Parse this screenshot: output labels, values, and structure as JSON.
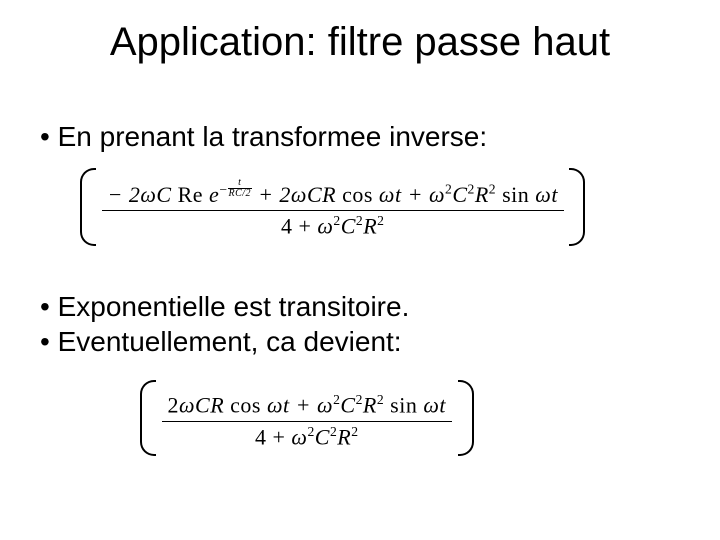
{
  "slide": {
    "title": "Application: filtre passe haut",
    "bullets": {
      "b1": "En prenant la transformee inverse:",
      "b2": "Exponentielle est transitoire.",
      "b3": "Eventuellement, ca devient:"
    },
    "formulas": {
      "f1": {
        "numerator_terms": [
          "− 2ωC Re",
          "e^{−t/(RC/2)}",
          "+ 2ωCR cos ωt",
          "+ ω²C²R² sin ωt"
        ],
        "exp_neg": "−",
        "exp_frac_num": "t",
        "exp_frac_den": "RC/2",
        "denominator": "4 + ω²C²R²",
        "n_part1": "− 2",
        "n_omega": "ω",
        "n_C": "C",
        "n_Re": " Re",
        "n_e": "e",
        "n_plus1": " + 2",
        "n_CR": "CR",
        "n_cos": " cos ",
        "n_t1": "t",
        "n_plus2": " + ",
        "n_sq": "2",
        "n_R": "R",
        "n_sin": " sin ",
        "n_t2": "t",
        "d_4plus": "4 + ",
        "d_rest": ""
      },
      "f2": {
        "n_part1": "2",
        "n_omega": "ω",
        "n_CR": "CR",
        "n_cos": " cos ",
        "n_t1": "t",
        "n_plus": " + ",
        "n_sq": "2",
        "n_C": "C",
        "n_R": "R",
        "n_sin": " sin ",
        "n_t2": "t",
        "d_4plus": "4 + "
      }
    }
  }
}
